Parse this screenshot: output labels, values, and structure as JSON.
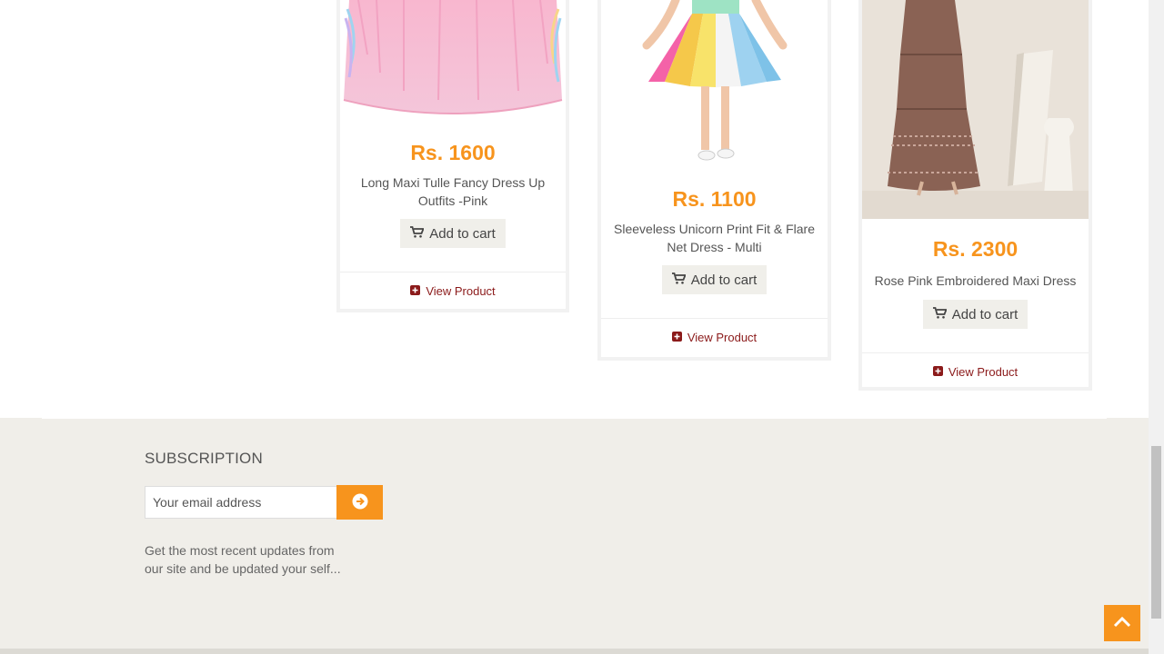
{
  "products": [
    {
      "price": "Rs. 1600",
      "name": "Long Maxi Tulle Fancy Dress Up Outfits -Pink",
      "add_to_cart": "Add to cart",
      "view": "View Product"
    },
    {
      "price": "Rs. 1100",
      "name": "Sleeveless Unicorn Print Fit & Flare Net Dress - Multi",
      "add_to_cart": "Add to cart",
      "view": "View Product"
    },
    {
      "price": "Rs. 2300",
      "name": "Rose Pink Embroidered Maxi Dress",
      "add_to_cart": "Add to cart",
      "view": "View Product"
    }
  ],
  "subscription": {
    "title": "SUBSCRIPTION",
    "placeholder": "Your email address",
    "description": "Get the most recent updates from our site and be updated your self..."
  },
  "colors": {
    "accent": "#f7941d",
    "link": "#8b1a1a",
    "footer_bg": "#f0eee9"
  },
  "icons": [
    "cart-icon",
    "plus-square-icon",
    "arrow-circle-right-icon",
    "chevron-up-icon"
  ]
}
